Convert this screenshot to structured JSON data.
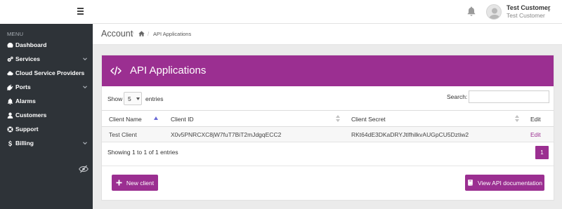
{
  "topbar": {
    "user_name": "Test Customer",
    "user_subtitle": "Test Customer",
    "icons": [
      "hamburger-icon",
      "bell-icon",
      "user-avatar",
      "caret-down-icon"
    ]
  },
  "sidebar": {
    "menu_title": "MENU",
    "items": [
      {
        "label": "Dashboard",
        "icon": "dashboard-icon",
        "has_submenu": false
      },
      {
        "label": "Services",
        "icon": "cogs-icon",
        "has_submenu": true
      },
      {
        "label": "Cloud Service Providers",
        "icon": "cloud-icon",
        "has_submenu": false
      },
      {
        "label": "Ports",
        "icon": "plug-icon",
        "has_submenu": true
      },
      {
        "label": "Alarms",
        "icon": "bell-icon",
        "has_submenu": false
      },
      {
        "label": "Customers",
        "icon": "user-icon",
        "has_submenu": false
      },
      {
        "label": "Support",
        "icon": "lifebuoy-icon",
        "has_submenu": false
      },
      {
        "label": "Billing",
        "icon": "dollar-icon",
        "has_submenu": true
      }
    ],
    "toggle_icon": "eye-slash-icon"
  },
  "header": {
    "title": "Account",
    "breadcrumb_home_icon": "home-icon",
    "breadcrumb_current": "API Applications"
  },
  "card": {
    "title": "API Applications",
    "title_icon": "code-icon",
    "accent_color": "#9b2f91",
    "length": {
      "show_label": "Show",
      "value": "5",
      "entries_label": "entries"
    },
    "search": {
      "label": "Search:",
      "value": "",
      "placeholder": ""
    },
    "table": {
      "columns": [
        "Client Name",
        "Client ID",
        "Client Secret",
        "Edit"
      ],
      "rows": [
        {
          "client_name": "Test Client",
          "client_id": "X0v5PNRCXC8jW7fuT7BiT2mJdgqECC2",
          "client_secret": "RKt64dE3DKaDRYJtIfhilkvAUGpCU5Dztiw2",
          "edit": "Edit"
        }
      ]
    },
    "info": "Showing 1 to 1 of 1 entries",
    "pagination": {
      "current_page": "1"
    },
    "buttons": {
      "new_client": "New client",
      "view_docs": "View API documentation"
    }
  }
}
